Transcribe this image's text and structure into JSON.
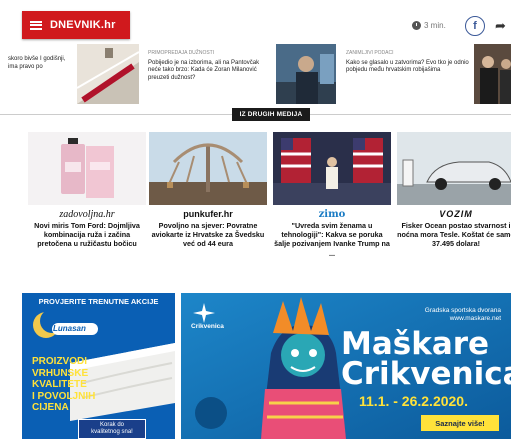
{
  "header": {
    "logo_text": "DNEVNIK.hr",
    "read_time": "3 min.",
    "facebook_label": "f",
    "share_glyph": "➦"
  },
  "strip": {
    "items": [
      {
        "category": "",
        "text": "skoro bivše I godišnji, ima pravo po"
      },
      {
        "category": "PRIMOPREDAJA DUŽNOSTI",
        "text": "Pobijedio je na izborima, ali na Pantovčak neće tako brzo: Kada će Zoran Milanović preuzeti dužnost?"
      },
      {
        "category": "ZANIMLJIVI PODACI",
        "text": "Kako se glasalo u zatvorima? Evo tko je odnio pobjedu među hrvatskim robijašima"
      }
    ]
  },
  "section_label": "IZ DRUGIH MEDIJA",
  "cards": [
    {
      "source": "zadovoljna.hr",
      "title": "Novi miris Tom Ford: Dojmljiva kombinacija ruža i začina pretočena u ružičastu bočicu"
    },
    {
      "source": "punkufer.hr",
      "title": "Povoljno na sjever: Povratne aviokarte iz Hrvatske za Švedsku već od 44 eura"
    },
    {
      "source": "zimo",
      "title": "\"Uvreda svim ženama u tehnologiji\": Kakva se poruka šalje pozivanjem Ivanke Trump na ..."
    },
    {
      "source": "VOZIM",
      "title": "Fisker Ocean postao stvarnost i noćna mora Tesle. Koštat će samo 37.495 dolara!"
    }
  ],
  "ad_left": {
    "header": "PROVJERITE TRENUTNE AKCIJE",
    "brand": "Lunasan",
    "lines": [
      "PROIZVODI",
      "VRHUNSKE",
      "KVALITETE",
      "I POVOLJNIH",
      "CIJENA"
    ],
    "badge_line1": "Korak do",
    "badge_line2": "kvalitetnog sna!"
  },
  "ad_right": {
    "venue": "Gradska sportska dvorana",
    "url": "www.maskare.net",
    "logo_text": "Crikvenica",
    "title1": "Maškare",
    "title2": "Crikvenica",
    "dates": "11.1. - 26.2.2020.",
    "cta": "Saznajte više!"
  }
}
